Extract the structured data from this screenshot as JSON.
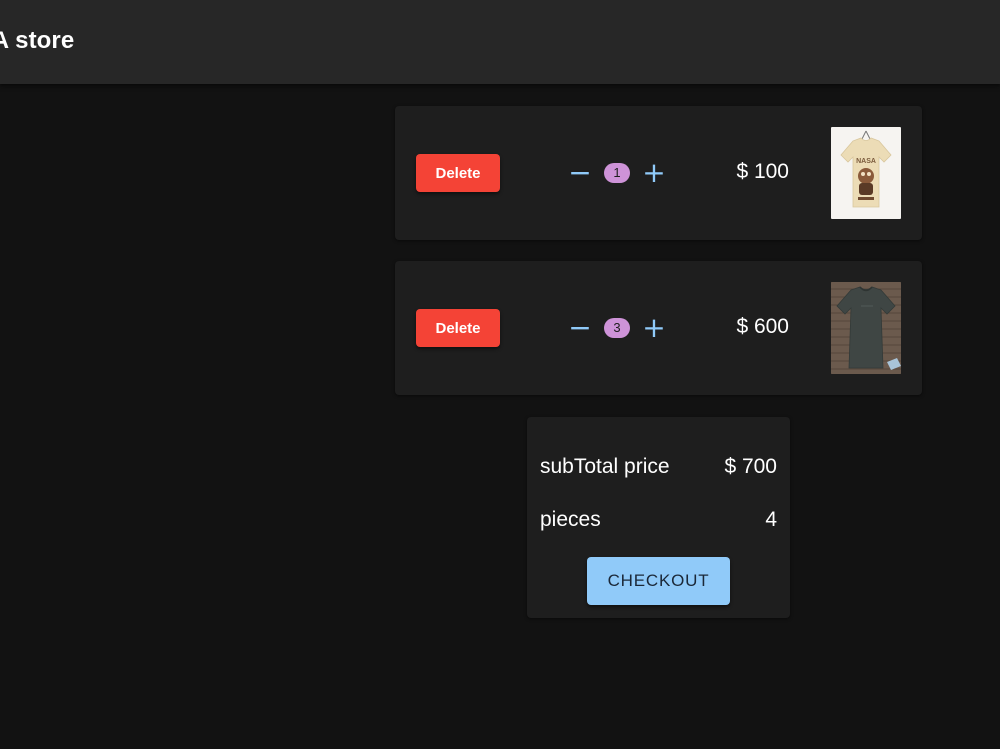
{
  "app": {
    "title": "'A store"
  },
  "cart": {
    "items": [
      {
        "delete_label": "Delete",
        "minus_icon": "minus-icon",
        "plus_icon": "plus-icon",
        "quantity": "1",
        "price": "$ 100",
        "image": "beige-nasa-tshirt"
      },
      {
        "delete_label": "Delete",
        "minus_icon": "minus-icon",
        "plus_icon": "plus-icon",
        "quantity": "3",
        "price": "$ 600",
        "image": "dark-gray-tshirt"
      }
    ]
  },
  "summary": {
    "subtotal_label": "subTotal price",
    "subtotal_value": "$ 700",
    "pieces_label": "pieces",
    "pieces_value": "4",
    "checkout_label": "CHECKOUT"
  },
  "colors": {
    "background": "#121212",
    "appbar": "#272727",
    "card": "#1e1e1e",
    "delete": "#f44336",
    "accent": "#90caf9",
    "badge": "#ce93d8"
  }
}
